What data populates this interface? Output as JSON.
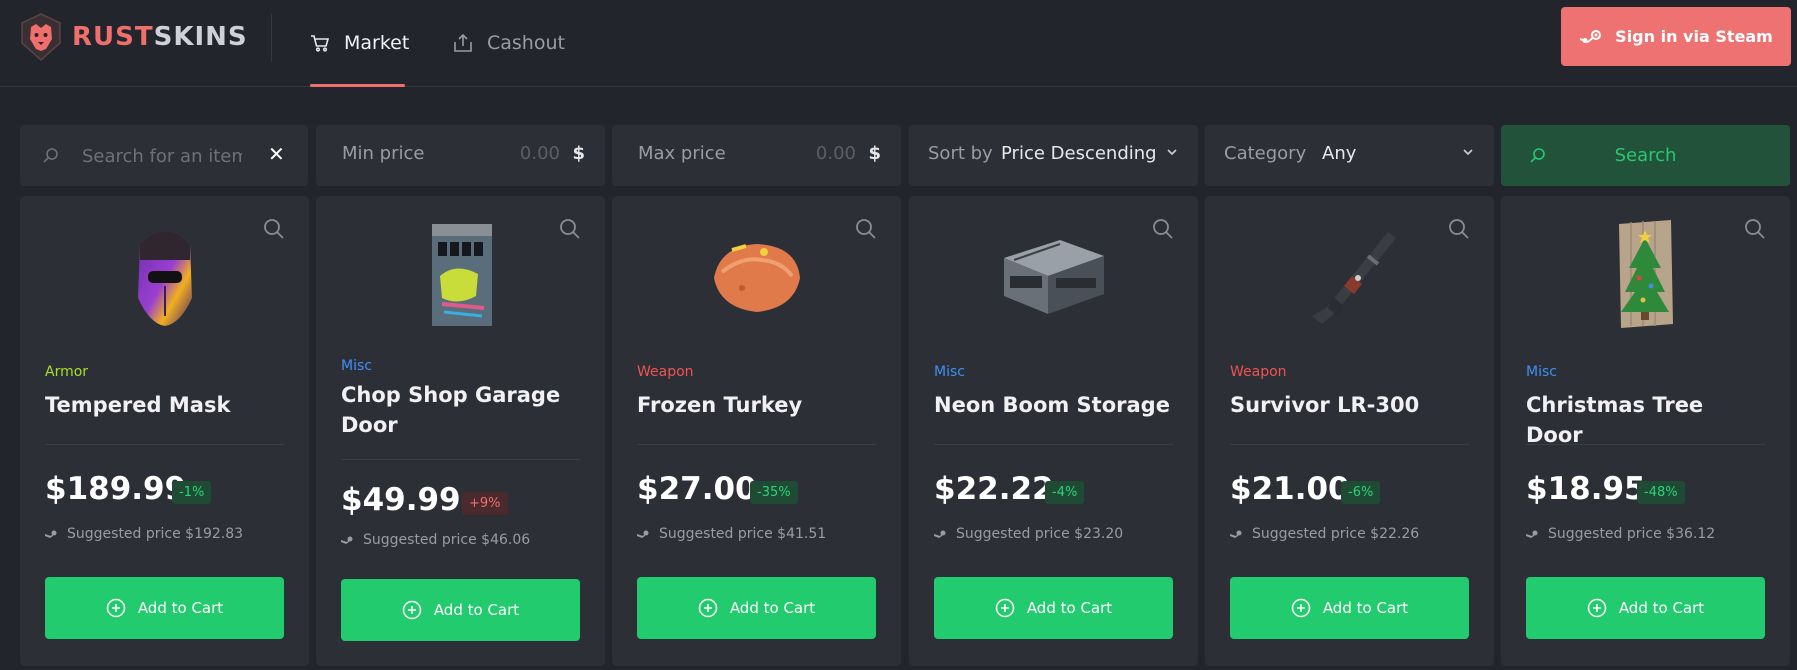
{
  "header": {
    "logo_part1": "RUST",
    "logo_part2": "SKINS",
    "nav": [
      {
        "label": "Market",
        "active": true
      },
      {
        "label": "Cashout",
        "active": false
      }
    ],
    "signin_label": "Sign in via Steam"
  },
  "filters": {
    "search_placeholder": "Search for an item",
    "search_clear": "✕",
    "min_label": "Min price",
    "min_placeholder": "0.00",
    "max_label": "Max price",
    "max_placeholder": "0.00",
    "currency": "$",
    "sort_label": "Sort by",
    "sort_value": "Price Descending",
    "category_label": "Category",
    "category_value": "Any",
    "search_button": "Search"
  },
  "colors": {
    "accent": "#ef7272",
    "green": "#22cc6e",
    "armor": "#a6e02a",
    "misc": "#3d8ff5",
    "weapon": "#ef5350"
  },
  "items": [
    {
      "category": "Armor",
      "category_color": "#a6e02a",
      "name": "Tempered Mask",
      "price": "$189.99",
      "change": "-1%",
      "change_dir": "neg",
      "suggested": "Suggested price $192.83",
      "add_label": "Add to Cart",
      "icon": "tempered-mask-icon"
    },
    {
      "category": "Misc",
      "category_color": "#3d8ff5",
      "name": "Chop Shop Garage Door",
      "price": "$49.99",
      "change": "+9%",
      "change_dir": "pos",
      "suggested": "Suggested price $46.06",
      "add_label": "Add to Cart",
      "icon": "garage-door-icon"
    },
    {
      "category": "Weapon",
      "category_color": "#ef5350",
      "name": "Frozen Turkey",
      "price": "$27.00",
      "change": "-35%",
      "change_dir": "neg",
      "suggested": "Suggested price $41.51",
      "add_label": "Add to Cart",
      "icon": "turkey-icon"
    },
    {
      "category": "Misc",
      "category_color": "#3d8ff5",
      "name": "Neon Boom Storage",
      "price": "$22.22",
      "change": "-4%",
      "change_dir": "neg",
      "suggested": "Suggested price $23.20",
      "add_label": "Add to Cart",
      "icon": "storage-box-icon"
    },
    {
      "category": "Weapon",
      "category_color": "#ef5350",
      "name": "Survivor LR-300",
      "price": "$21.00",
      "change": "-6%",
      "change_dir": "neg",
      "suggested": "Suggested price $22.26",
      "add_label": "Add to Cart",
      "icon": "rifle-icon"
    },
    {
      "category": "Misc",
      "category_color": "#3d8ff5",
      "name": "Christmas Tree Door",
      "price": "$18.95",
      "change": "-48%",
      "change_dir": "neg",
      "suggested": "Suggested price $36.12",
      "add_label": "Add to Cart",
      "icon": "christmas-door-icon"
    }
  ]
}
